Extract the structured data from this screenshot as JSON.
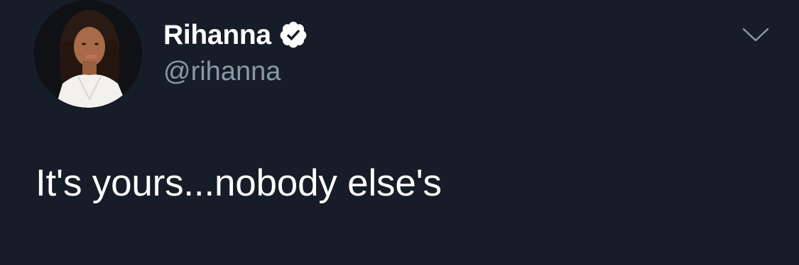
{
  "tweet": {
    "author": {
      "display_name": "Rihanna",
      "handle": "@rihanna",
      "verified": true,
      "avatar_icon": "profile-photo"
    },
    "text": "It's yours...nobody else's",
    "menu_icon": "chevron-down-icon"
  },
  "colors": {
    "background": "#161c28",
    "text": "#ffffff",
    "secondary_text": "#8899a6",
    "verified_badge": "#ffffff"
  }
}
